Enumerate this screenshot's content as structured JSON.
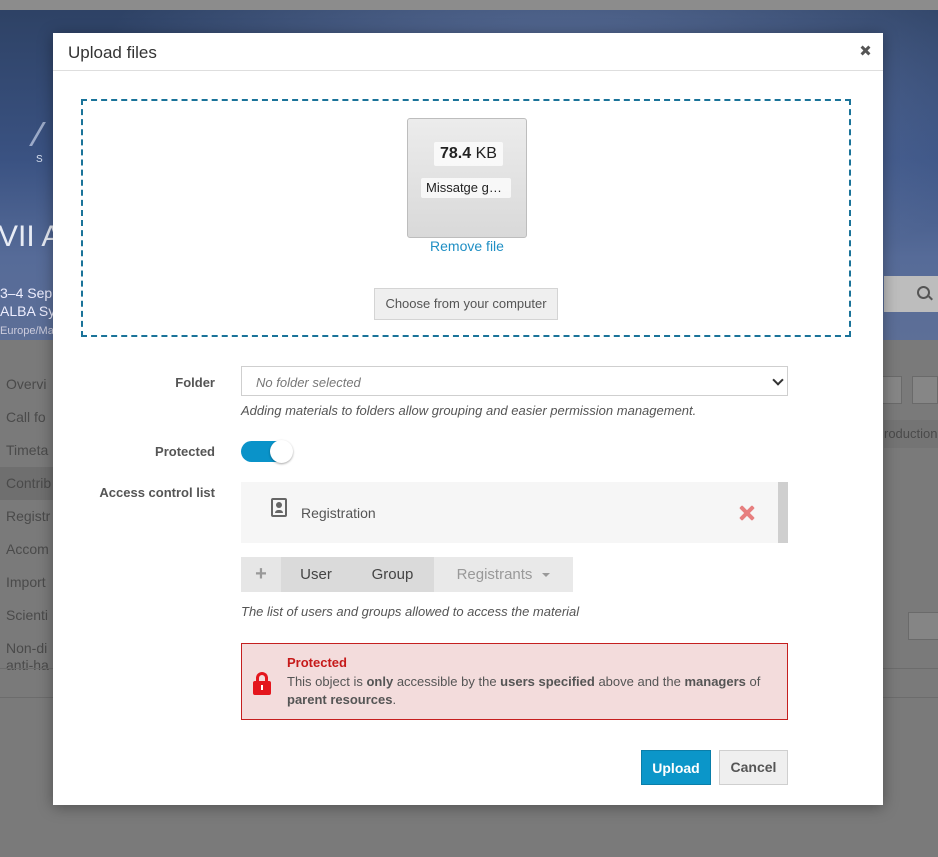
{
  "background": {
    "title": "VII A",
    "date": "3–4 Sep",
    "venue": "ALBA Sy",
    "timezone": "Europe/Ma",
    "logo_text": "S",
    "menu": [
      "Overvi",
      "Call fo",
      "Timeta",
      "Contrib",
      "Registr",
      "Accom",
      "Import",
      "Scienti"
    ],
    "menu_multi": [
      "Non-di",
      "anti-ha"
    ],
    "right_tab": "roduction"
  },
  "modal": {
    "title": "Upload files",
    "file": {
      "size_value": "78.4",
      "size_unit": "KB",
      "name": "Missatge gravat"
    },
    "remove_file": "Remove file",
    "choose_button": "Choose from your computer",
    "folder": {
      "label": "Folder",
      "placeholder": "No folder selected",
      "hint": "Adding materials to folders allow grouping and easier permission management."
    },
    "protected": {
      "label": "Protected",
      "enabled": true
    },
    "acl": {
      "label": "Access control list",
      "entries": [
        {
          "label": "Registration",
          "icon": "registration-form-icon"
        }
      ],
      "buttons": {
        "add": "+",
        "user": "User",
        "group": "Group",
        "registrants": "Registrants"
      },
      "hint": "The list of users and groups allowed to access the material"
    },
    "alert": {
      "title": "Protected",
      "text_1": "This object is ",
      "text_only": "only",
      "text_2": " accessible by the ",
      "text_users": "users specified",
      "text_3": " above and the ",
      "text_managers": "managers",
      "text_4": " of ",
      "text_parent": "parent resources",
      "text_5": "."
    },
    "upload_button": "Upload",
    "cancel_button": "Cancel"
  }
}
